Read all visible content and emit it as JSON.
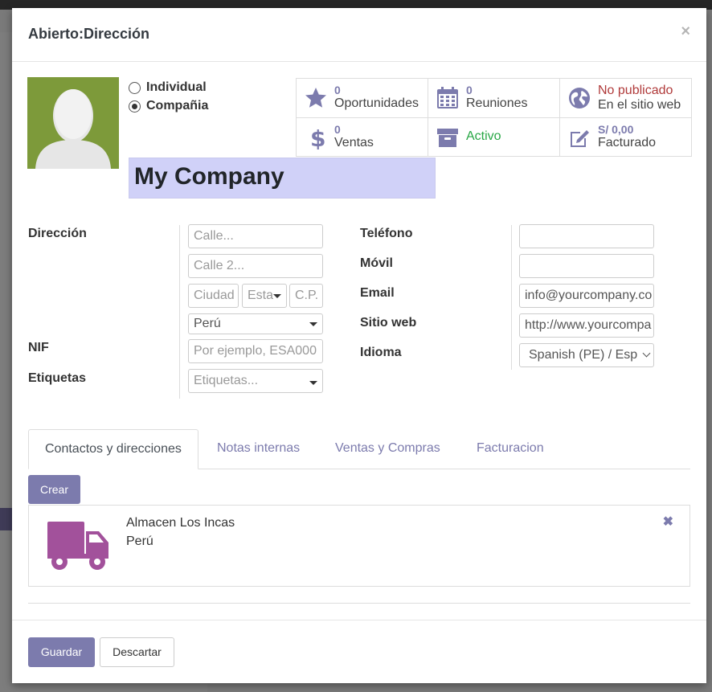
{
  "modal": {
    "title": "Abierto:Dirección",
    "close": "×"
  },
  "type_options": [
    {
      "label": "Individual",
      "checked": false
    },
    {
      "label": "Compañia",
      "checked": true
    }
  ],
  "company_name": "My Company",
  "stats": [
    {
      "num": "0",
      "label": "Oportunidades",
      "icon": "star-icon"
    },
    {
      "num": "0",
      "label": "Reuniones",
      "icon": "calendar-icon"
    },
    {
      "num": "No publicado",
      "label": "En el sitio web",
      "icon": "globe-icon"
    },
    {
      "num": "0",
      "label": "Ventas",
      "icon": "dollar-icon"
    },
    {
      "num": "",
      "label": "Activo",
      "icon": "archive-icon"
    },
    {
      "num": "S/ 0,00",
      "label": "Facturado",
      "icon": "edit-icon"
    }
  ],
  "labels": {
    "direccion": "Dirección",
    "nif": "NIF",
    "etiquetas": "Etiquetas",
    "telefono": "Teléfono",
    "movil": "Móvil",
    "email": "Email",
    "sitio_web": "Sitio web",
    "idioma": "Idioma"
  },
  "fields": {
    "calle_placeholder": "Calle...",
    "calle2_placeholder": "Calle 2...",
    "ciudad_placeholder": "Ciudad",
    "estado_placeholder": "Esta",
    "cp_placeholder": "C.P.",
    "pais_value": "Perú",
    "nif_placeholder": "Por ejemplo, ESA000",
    "etiquetas_placeholder": "Etiquetas...",
    "telefono_value": "",
    "movil_value": "",
    "email_value": "info@yourcompany.co",
    "website_value": "http://www.yourcompa",
    "idioma_value": "Spanish (PE) / Esp"
  },
  "tabs": [
    "Contactos y direcciones",
    "Notas internas",
    "Ventas y Compras",
    "Facturacion"
  ],
  "create_button": "Crear",
  "contact_card": {
    "name": "Almacen Los Incas",
    "country": "Perú",
    "icon": "truck-icon",
    "delete": "✖"
  },
  "footer": {
    "save": "Guardar",
    "discard": "Descartar"
  },
  "colors": {
    "primary": "#7c7bad",
    "avatar_bg": "#7d9a3a",
    "name_bg": "#d0d1f8",
    "truck": "#a2519b",
    "unpublished": "#b03a3a",
    "active": "#28a745"
  }
}
